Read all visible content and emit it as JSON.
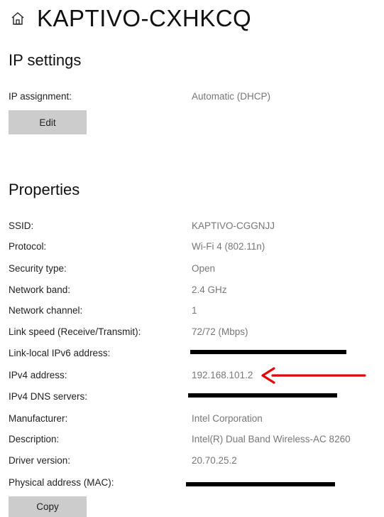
{
  "header": {
    "icon": "home-icon",
    "title": "KAPTIVO-CXHKCQ"
  },
  "ip_settings": {
    "title": "IP settings",
    "rows": [
      {
        "label": "IP assignment:",
        "value": "Automatic (DHCP)"
      }
    ],
    "edit_label": "Edit"
  },
  "properties": {
    "title": "Properties",
    "rows": [
      {
        "label": "SSID:",
        "value": "KAPTIVO-CGGNJJ"
      },
      {
        "label": "Protocol:",
        "value": "Wi-Fi 4 (802.11n)"
      },
      {
        "label": "Security type:",
        "value": "Open"
      },
      {
        "label": "Network band:",
        "value": "2.4 GHz"
      },
      {
        "label": "Network channel:",
        "value": "1"
      },
      {
        "label": "Link speed (Receive/Transmit):",
        "value": "72/72 (Mbps)"
      },
      {
        "label": "Link-local IPv6 address:",
        "value": ""
      },
      {
        "label": "IPv4 address:",
        "value": "192.168.101.2"
      },
      {
        "label": "IPv4 DNS servers:",
        "value": ""
      },
      {
        "label": "Manufacturer:",
        "value": "Intel Corporation"
      },
      {
        "label": "Description:",
        "value": "Intel(R) Dual Band Wireless-AC 8260"
      },
      {
        "label": "Driver version:",
        "value": "20.70.25.2"
      },
      {
        "label": "Physical address (MAC):",
        "value": ""
      }
    ],
    "copy_label": "Copy"
  },
  "annotation": {
    "icon": "red-arrow-icon",
    "color": "#e8000b"
  },
  "redaction_color": "#000000"
}
